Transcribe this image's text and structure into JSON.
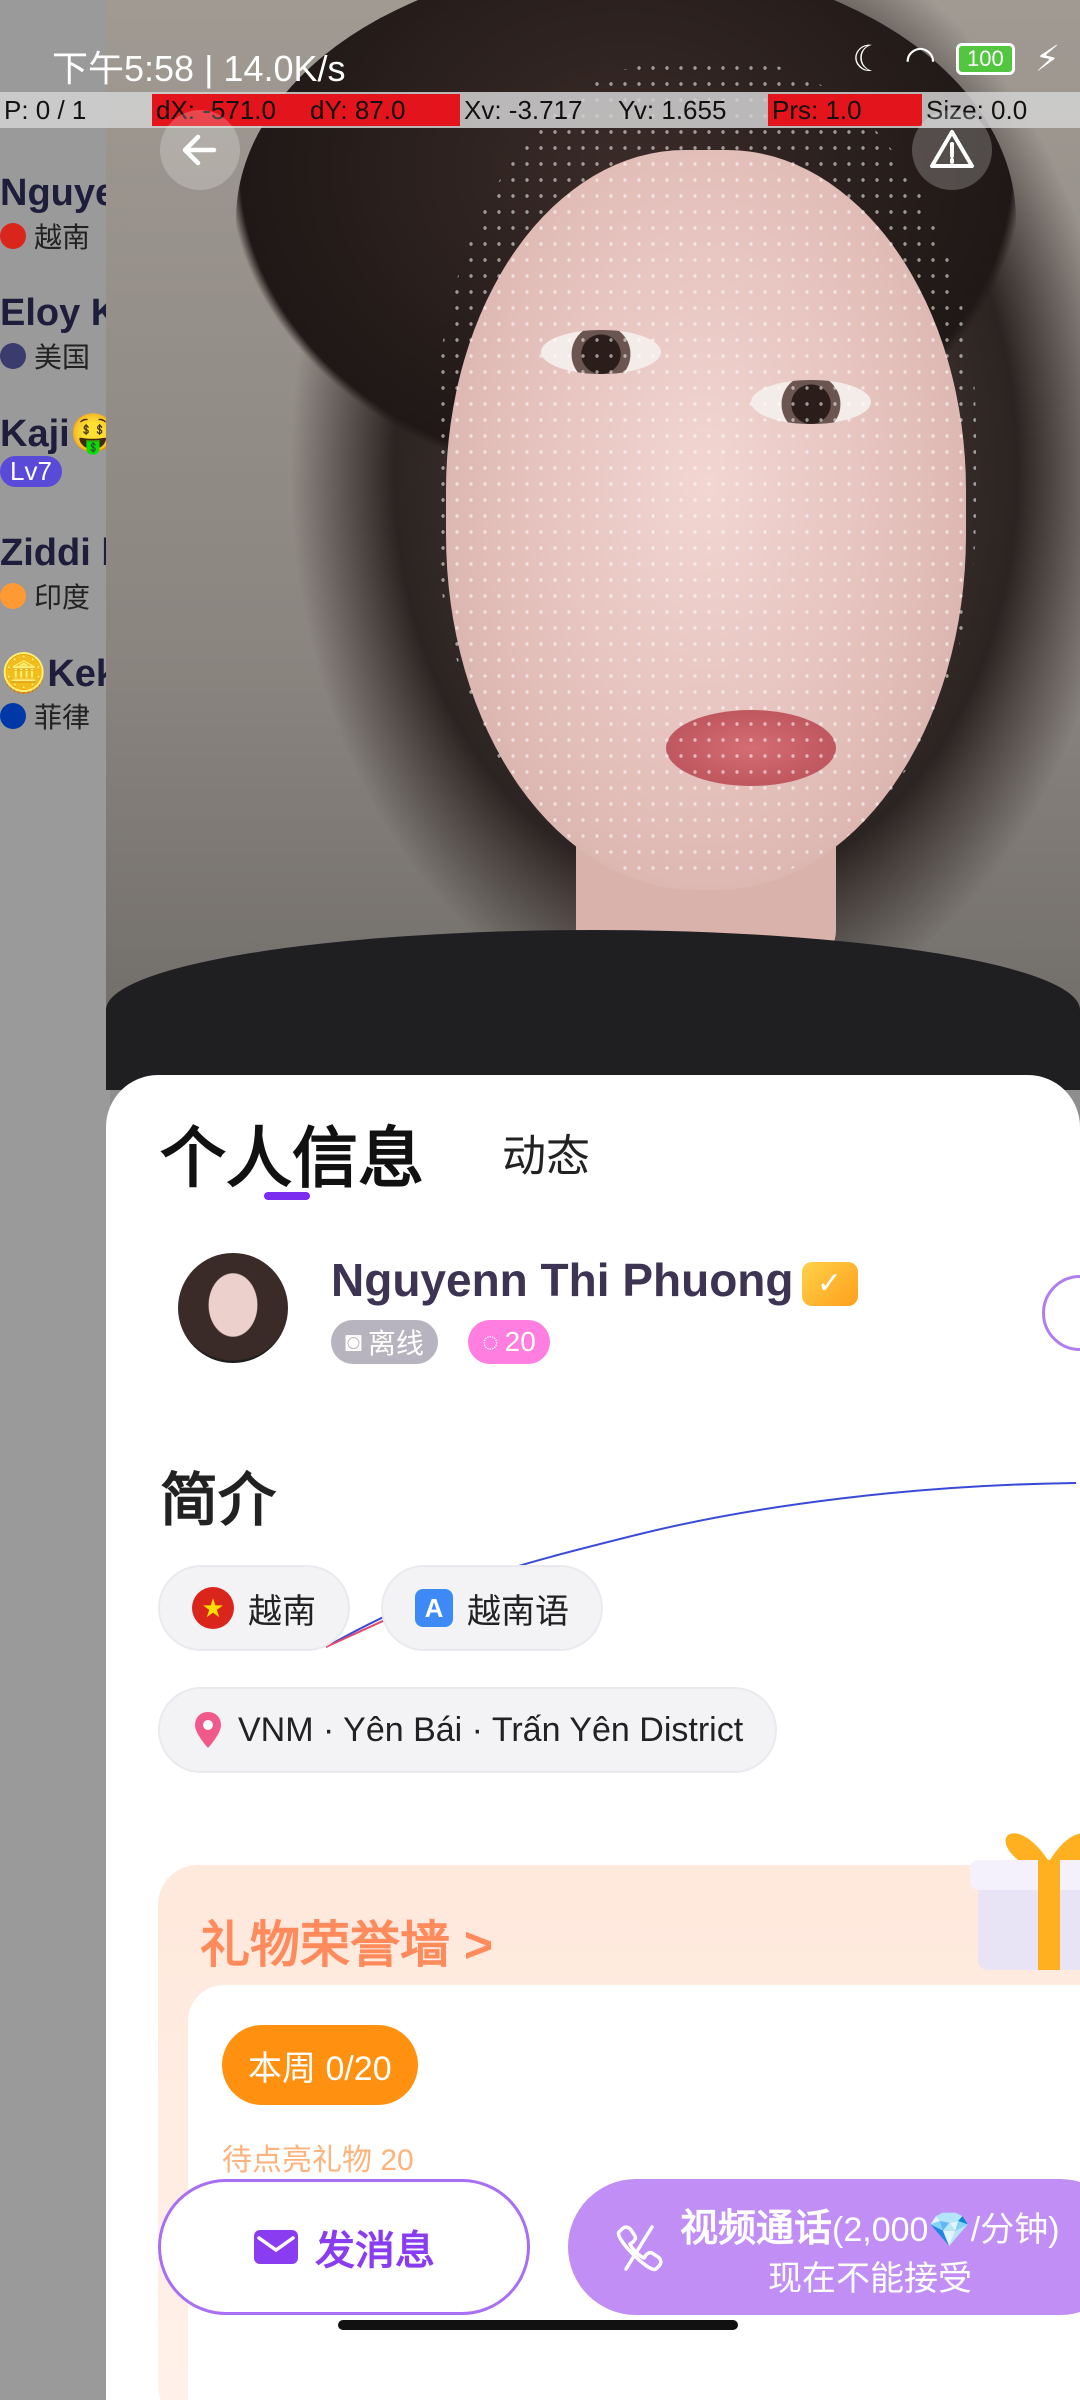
{
  "status_bar": {
    "time": "下午5:58 | 14.0K/s",
    "battery": "100"
  },
  "debug_overlay": {
    "p": "P: 0 / 1",
    "dx": "dX: -571.0",
    "dy": "dY: 87.0",
    "xv": "Xv: -3.717",
    "yv": "Yv: 1.655",
    "prs": "Prs: 1.0",
    "size": "Size: 0.0"
  },
  "background_list": [
    {
      "name": "Nguye",
      "country": "越南",
      "flag": "#da251d"
    },
    {
      "name": "Eloy K",
      "country": "美国",
      "flag": "#3c3b6e"
    },
    {
      "name": "Kaji🤑",
      "badge": "Lv7"
    },
    {
      "name": "Ziddi b",
      "country": "印度",
      "flag": "#ff9933"
    },
    {
      "name": "🪙Kek",
      "country": "菲律",
      "flag": "#0038a8"
    }
  ],
  "tabs": [
    {
      "label": "个人信息",
      "active": true
    },
    {
      "label": "动态",
      "active": false
    }
  ],
  "profile": {
    "name": "Nguyenn Thi Phuong",
    "status": "离线",
    "chat_count": "20"
  },
  "intro": {
    "heading": "简介",
    "country": "越南",
    "language": "越南语",
    "location": "VNM · Yên Bái · Trấn Yên District"
  },
  "gift_wall": {
    "title": "礼物荣誉墙 >",
    "week_label": "本周 0/20",
    "pending_text": "待点亮礼物 20"
  },
  "actions": {
    "message": "发消息",
    "video_call": "视频通话",
    "video_rate": "(2,000💎/分钟)",
    "video_status": "现在不能接受"
  },
  "colors": {
    "accent": "#8a3cf0",
    "video_button": "#c08ef5",
    "gift_orange": "#ff9010"
  }
}
